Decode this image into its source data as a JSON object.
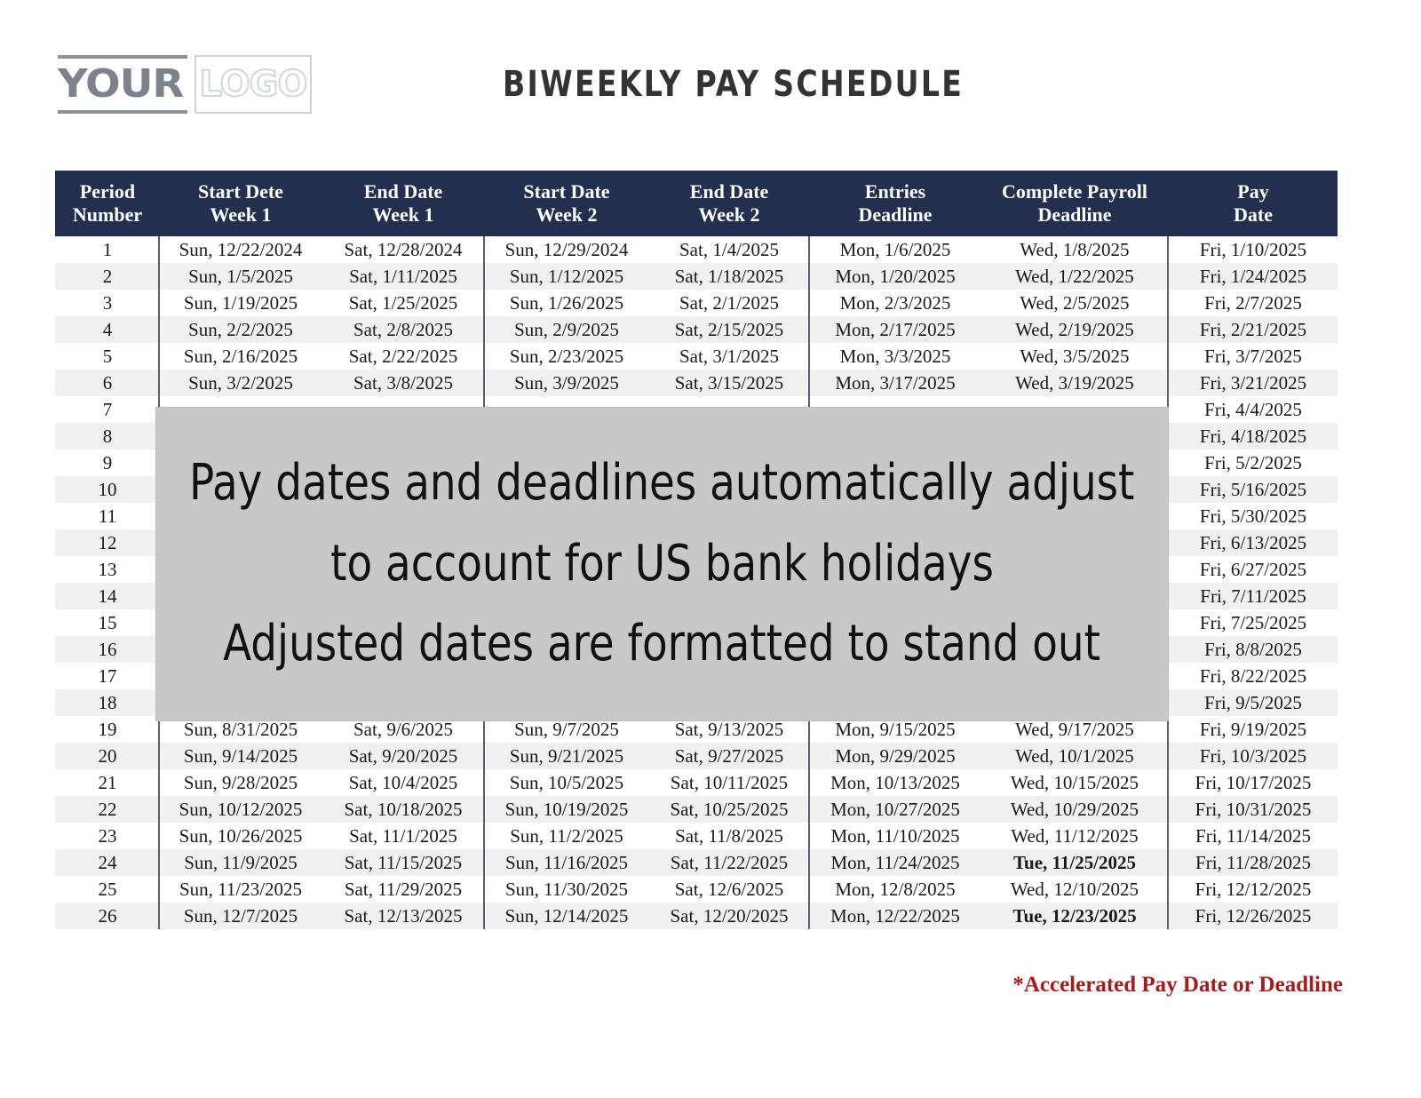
{
  "branding": {
    "logo_primary_text": "YOUR",
    "logo_secondary_text": "LOGO"
  },
  "header": {
    "title": "BIWEEKLY PAY SCHEDULE"
  },
  "table": {
    "columns": [
      "Period\nNumber",
      "Start Dete\nWeek 1",
      "End Date\nWeek 1",
      "Start Date\nWeek 2",
      "End Date\nWeek 2",
      "Entries\nDeadline",
      "Complete Payroll\nDeadline",
      "Pay\nDate"
    ],
    "columns_split": [
      {
        "line1": "Period",
        "line2": "Number"
      },
      {
        "line1": "Start Dete",
        "line2": "Week 1"
      },
      {
        "line1": "End Date",
        "line2": "Week 1"
      },
      {
        "line1": "Start Date",
        "line2": "Week 2"
      },
      {
        "line1": "End Date",
        "line2": "Week 2"
      },
      {
        "line1": "Entries",
        "line2": "Deadline"
      },
      {
        "line1": "Complete Payroll",
        "line2": "Deadline"
      },
      {
        "line1": "Pay",
        "line2": "Date"
      }
    ],
    "rows": [
      {
        "period": "1",
        "start_w1": "Sun, 12/22/2024",
        "end_w1": "Sat, 12/28/2024",
        "start_w2": "Sun, 12/29/2024",
        "end_w2": "Sat, 1/4/2025",
        "entries_deadline": "Mon, 1/6/2025",
        "payroll_deadline": "Wed, 1/8/2025",
        "pay_date": "Fri, 1/10/2025",
        "payroll_deadline_accelerated": false,
        "hidden": false
      },
      {
        "period": "2",
        "start_w1": "Sun, 1/5/2025",
        "end_w1": "Sat, 1/11/2025",
        "start_w2": "Sun, 1/12/2025",
        "end_w2": "Sat, 1/18/2025",
        "entries_deadline": "Mon, 1/20/2025",
        "payroll_deadline": "Wed, 1/22/2025",
        "pay_date": "Fri, 1/24/2025",
        "payroll_deadline_accelerated": false,
        "hidden": false
      },
      {
        "period": "3",
        "start_w1": "Sun, 1/19/2025",
        "end_w1": "Sat, 1/25/2025",
        "start_w2": "Sun, 1/26/2025",
        "end_w2": "Sat, 2/1/2025",
        "entries_deadline": "Mon, 2/3/2025",
        "payroll_deadline": "Wed, 2/5/2025",
        "pay_date": "Fri, 2/7/2025",
        "payroll_deadline_accelerated": false,
        "hidden": false
      },
      {
        "period": "4",
        "start_w1": "Sun, 2/2/2025",
        "end_w1": "Sat, 2/8/2025",
        "start_w2": "Sun, 2/9/2025",
        "end_w2": "Sat, 2/15/2025",
        "entries_deadline": "Mon, 2/17/2025",
        "payroll_deadline": "Wed, 2/19/2025",
        "pay_date": "Fri, 2/21/2025",
        "payroll_deadline_accelerated": false,
        "hidden": false
      },
      {
        "period": "5",
        "start_w1": "Sun, 2/16/2025",
        "end_w1": "Sat, 2/22/2025",
        "start_w2": "Sun, 2/23/2025",
        "end_w2": "Sat, 3/1/2025",
        "entries_deadline": "Mon, 3/3/2025",
        "payroll_deadline": "Wed, 3/5/2025",
        "pay_date": "Fri, 3/7/2025",
        "payroll_deadline_accelerated": false,
        "hidden": false
      },
      {
        "period": "6",
        "start_w1": "Sun, 3/2/2025",
        "end_w1": "Sat, 3/8/2025",
        "start_w2": "Sun, 3/9/2025",
        "end_w2": "Sat, 3/15/2025",
        "entries_deadline": "Mon, 3/17/2025",
        "payroll_deadline": "Wed, 3/19/2025",
        "pay_date": "Fri, 3/21/2025",
        "payroll_deadline_accelerated": false,
        "hidden": false
      },
      {
        "period": "7",
        "start_w1": "",
        "end_w1": "",
        "start_w2": "",
        "end_w2": "",
        "entries_deadline": "",
        "payroll_deadline": "",
        "pay_date": "Fri, 4/4/2025",
        "payroll_deadline_accelerated": false,
        "hidden": true
      },
      {
        "period": "8",
        "start_w1": "",
        "end_w1": "",
        "start_w2": "",
        "end_w2": "",
        "entries_deadline": "",
        "payroll_deadline": "",
        "pay_date": "Fri, 4/18/2025",
        "payroll_deadline_accelerated": false,
        "hidden": true
      },
      {
        "period": "9",
        "start_w1": "",
        "end_w1": "",
        "start_w2": "",
        "end_w2": "",
        "entries_deadline": "",
        "payroll_deadline": "",
        "pay_date": "Fri, 5/2/2025",
        "payroll_deadline_accelerated": false,
        "hidden": true
      },
      {
        "period": "10",
        "start_w1": "",
        "end_w1": "",
        "start_w2": "",
        "end_w2": "",
        "entries_deadline": "",
        "payroll_deadline": "",
        "pay_date": "Fri, 5/16/2025",
        "payroll_deadline_accelerated": false,
        "hidden": true
      },
      {
        "period": "11",
        "start_w1": "",
        "end_w1": "",
        "start_w2": "",
        "end_w2": "",
        "entries_deadline": "",
        "payroll_deadline": "",
        "pay_date": "Fri, 5/30/2025",
        "payroll_deadline_accelerated": false,
        "hidden": true
      },
      {
        "period": "12",
        "start_w1": "",
        "end_w1": "",
        "start_w2": "",
        "end_w2": "",
        "entries_deadline": "",
        "payroll_deadline": "",
        "pay_date": "Fri, 6/13/2025",
        "payroll_deadline_accelerated": false,
        "hidden": true
      },
      {
        "period": "13",
        "start_w1": "",
        "end_w1": "",
        "start_w2": "",
        "end_w2": "",
        "entries_deadline": "",
        "payroll_deadline": "",
        "pay_date": "Fri, 6/27/2025",
        "payroll_deadline_accelerated": false,
        "hidden": true
      },
      {
        "period": "14",
        "start_w1": "",
        "end_w1": "",
        "start_w2": "",
        "end_w2": "",
        "entries_deadline": "",
        "payroll_deadline": "",
        "pay_date": "Fri, 7/11/2025",
        "payroll_deadline_accelerated": false,
        "hidden": true
      },
      {
        "period": "15",
        "start_w1": "",
        "end_w1": "",
        "start_w2": "",
        "end_w2": "",
        "entries_deadline": "",
        "payroll_deadline": "",
        "pay_date": "Fri, 7/25/2025",
        "payroll_deadline_accelerated": false,
        "hidden": true
      },
      {
        "period": "16",
        "start_w1": "",
        "end_w1": "",
        "start_w2": "",
        "end_w2": "",
        "entries_deadline": "",
        "payroll_deadline": "",
        "pay_date": "Fri, 8/8/2025",
        "payroll_deadline_accelerated": false,
        "hidden": true
      },
      {
        "period": "17",
        "start_w1": "",
        "end_w1": "",
        "start_w2": "",
        "end_w2": "",
        "entries_deadline": "",
        "payroll_deadline": "",
        "pay_date": "Fri, 8/22/2025",
        "payroll_deadline_accelerated": false,
        "hidden": true
      },
      {
        "period": "18",
        "start_w1": "",
        "end_w1": "",
        "start_w2": "",
        "end_w2": "",
        "entries_deadline": "",
        "payroll_deadline": "",
        "pay_date": "Fri, 9/5/2025",
        "payroll_deadline_accelerated": false,
        "hidden": true
      },
      {
        "period": "19",
        "start_w1": "Sun, 8/31/2025",
        "end_w1": "Sat, 9/6/2025",
        "start_w2": "Sun, 9/7/2025",
        "end_w2": "Sat, 9/13/2025",
        "entries_deadline": "Mon, 9/15/2025",
        "payroll_deadline": "Wed, 9/17/2025",
        "pay_date": "Fri, 9/19/2025",
        "payroll_deadline_accelerated": false,
        "hidden": false
      },
      {
        "period": "20",
        "start_w1": "Sun, 9/14/2025",
        "end_w1": "Sat, 9/20/2025",
        "start_w2": "Sun, 9/21/2025",
        "end_w2": "Sat, 9/27/2025",
        "entries_deadline": "Mon, 9/29/2025",
        "payroll_deadline": "Wed, 10/1/2025",
        "pay_date": "Fri, 10/3/2025",
        "payroll_deadline_accelerated": false,
        "hidden": false
      },
      {
        "period": "21",
        "start_w1": "Sun, 9/28/2025",
        "end_w1": "Sat, 10/4/2025",
        "start_w2": "Sun, 10/5/2025",
        "end_w2": "Sat, 10/11/2025",
        "entries_deadline": "Mon, 10/13/2025",
        "payroll_deadline": "Wed, 10/15/2025",
        "pay_date": "Fri, 10/17/2025",
        "payroll_deadline_accelerated": false,
        "hidden": false
      },
      {
        "period": "22",
        "start_w1": "Sun, 10/12/2025",
        "end_w1": "Sat, 10/18/2025",
        "start_w2": "Sun, 10/19/2025",
        "end_w2": "Sat, 10/25/2025",
        "entries_deadline": "Mon, 10/27/2025",
        "payroll_deadline": "Wed, 10/29/2025",
        "pay_date": "Fri, 10/31/2025",
        "payroll_deadline_accelerated": false,
        "hidden": false
      },
      {
        "period": "23",
        "start_w1": "Sun, 10/26/2025",
        "end_w1": "Sat, 11/1/2025",
        "start_w2": "Sun, 11/2/2025",
        "end_w2": "Sat, 11/8/2025",
        "entries_deadline": "Mon, 11/10/2025",
        "payroll_deadline": "Wed, 11/12/2025",
        "pay_date": "Fri, 11/14/2025",
        "payroll_deadline_accelerated": false,
        "hidden": false
      },
      {
        "period": "24",
        "start_w1": "Sun, 11/9/2025",
        "end_w1": "Sat, 11/15/2025",
        "start_w2": "Sun, 11/16/2025",
        "end_w2": "Sat, 11/22/2025",
        "entries_deadline": "Mon, 11/24/2025",
        "payroll_deadline": "Tue, 11/25/2025",
        "pay_date": "Fri, 11/28/2025",
        "payroll_deadline_accelerated": true,
        "hidden": false
      },
      {
        "period": "25",
        "start_w1": "Sun, 11/23/2025",
        "end_w1": "Sat, 11/29/2025",
        "start_w2": "Sun, 11/30/2025",
        "end_w2": "Sat, 12/6/2025",
        "entries_deadline": "Mon, 12/8/2025",
        "payroll_deadline": "Wed, 12/10/2025",
        "pay_date": "Fri, 12/12/2025",
        "payroll_deadline_accelerated": false,
        "hidden": false
      },
      {
        "period": "26",
        "start_w1": "Sun, 12/7/2025",
        "end_w1": "Sat, 12/13/2025",
        "start_w2": "Sun, 12/14/2025",
        "end_w2": "Sat, 12/20/2025",
        "entries_deadline": "Mon, 12/22/2025",
        "payroll_deadline": "Tue, 12/23/2025",
        "pay_date": "Fri, 12/26/2025",
        "payroll_deadline_accelerated": true,
        "hidden": false
      }
    ]
  },
  "overlay": {
    "lines": [
      "Pay dates and deadlines automatically adjust",
      "to account for US bank holidays",
      "Adjusted dates are formatted to stand out"
    ]
  },
  "footnote": {
    "text": "*Accelerated Pay Date or Deadline"
  },
  "colors": {
    "header_band": "#232f4e",
    "accent_red": "#a61b1b",
    "row_stripe": "#f0f0f0",
    "overlay_gray": "#c8c8c8",
    "logo_gray": "#7d838c"
  }
}
